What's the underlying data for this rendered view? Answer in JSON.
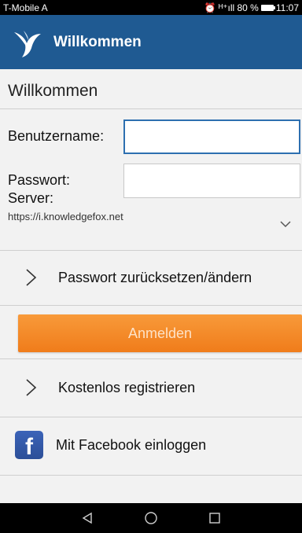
{
  "status_bar": {
    "carrier": "T-Mobile A",
    "indicators": "⏰ ᴴ⁺ıll 80 %",
    "time": "11:07"
  },
  "app_bar": {
    "title": "Willkommen",
    "logo_icon": "bird-logo-icon",
    "color": "#1f5a92"
  },
  "form": {
    "section_title": "Willkommen",
    "username_label": "Benutzername:",
    "username_value": "",
    "password_label": "Passwort:",
    "password_value": "",
    "server_label": "Server:",
    "server_value": "https://i.knowledgefox.net"
  },
  "actions": {
    "reset_password": "Passwort zurücksetzen/ändern",
    "login": "Anmelden",
    "register": "Kostenlos registrieren",
    "facebook": "Mit Facebook einloggen",
    "facebook_icon_letter": "f",
    "login_color": "#f28a2a"
  },
  "nav_bar": {
    "back_icon": "back-triangle-icon",
    "home_icon": "home-circle-icon",
    "recents_icon": "recents-square-icon"
  }
}
